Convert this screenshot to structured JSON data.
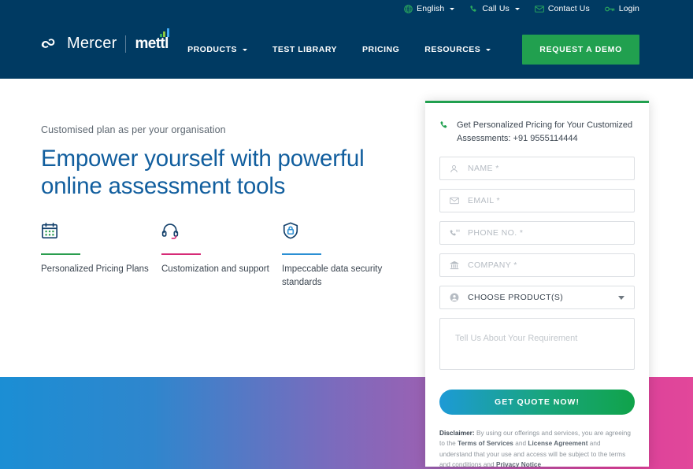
{
  "header": {
    "utility_bar": [
      {
        "icon": "globe-icon",
        "label": "English",
        "has_caret": true
      },
      {
        "icon": "phone-icon",
        "label": "Call Us",
        "has_caret": true
      },
      {
        "icon": "envelope-icon",
        "label": "Contact Us",
        "has_caret": false
      },
      {
        "icon": "key-icon",
        "label": "Login",
        "has_caret": false
      }
    ],
    "logo": {
      "mark": "mercer-wave-icon",
      "word": "Mercer",
      "product": "mettl"
    },
    "nav": [
      {
        "label": "PRODUCTS",
        "has_caret": true
      },
      {
        "label": "TEST LIBRARY",
        "has_caret": false
      },
      {
        "label": "PRICING",
        "has_caret": false
      },
      {
        "label": "RESOURCES",
        "has_caret": true
      }
    ],
    "cta": "REQUEST A DEMO",
    "bg_color": "#003a62",
    "cta_color": "#21a04f"
  },
  "hero": {
    "kicker": "Customised plan as per your organisation",
    "headline_line1": "Empower yourself with powerful",
    "headline_line2": "online assessment tools",
    "headline_color": "#115e9e",
    "features": [
      {
        "icon": "calendar-icon",
        "label": "Personalized Pricing Plans",
        "rule_color": "#2a9d4e"
      },
      {
        "icon": "headset-icon",
        "label": "Customization and support",
        "rule_color": "#d62b77"
      },
      {
        "icon": "shield-lock-icon",
        "label": "Impeccable data security standards",
        "rule_color": "#2b8fd4"
      }
    ]
  },
  "form_card": {
    "accent_color": "#21a04f",
    "header_icon": "phone-icon",
    "header_text": "Get Personalized Pricing for Your Customized Assessments: +91 9555114444",
    "fields": [
      {
        "icon": "person-icon",
        "placeholder": "NAME *",
        "value": ""
      },
      {
        "icon": "envelope-icon",
        "placeholder": "EMAIL *",
        "value": ""
      },
      {
        "icon": "phone-keypad-icon",
        "placeholder": "PHONE NO. *",
        "value": ""
      },
      {
        "icon": "bank-icon",
        "placeholder": "COMPANY *",
        "value": ""
      }
    ],
    "select": {
      "icon": "person-circle-icon",
      "placeholder": "CHOOSE PRODUCT(S)",
      "value": "",
      "caret": "chevron-down-icon"
    },
    "textarea": {
      "placeholder": "Tell Us About Your Requirement",
      "value": ""
    },
    "submit_label": "GET QUOTE NOW!",
    "disclaimer": {
      "label": "Disclaimer:",
      "part1": " By using our offerings and services, you are agreeing to the ",
      "link1": "Terms of Services",
      "part2": " and ",
      "link2": "License Agreement",
      "part3": " and understand that your use and access will be subject to the terms and conditions and ",
      "link3": "Privacy Notice"
    }
  },
  "bottom_band": {
    "gradient_start": "#1b8ed4",
    "gradient_mid": "#7b6bbd",
    "gradient_end": "#e2479a"
  }
}
